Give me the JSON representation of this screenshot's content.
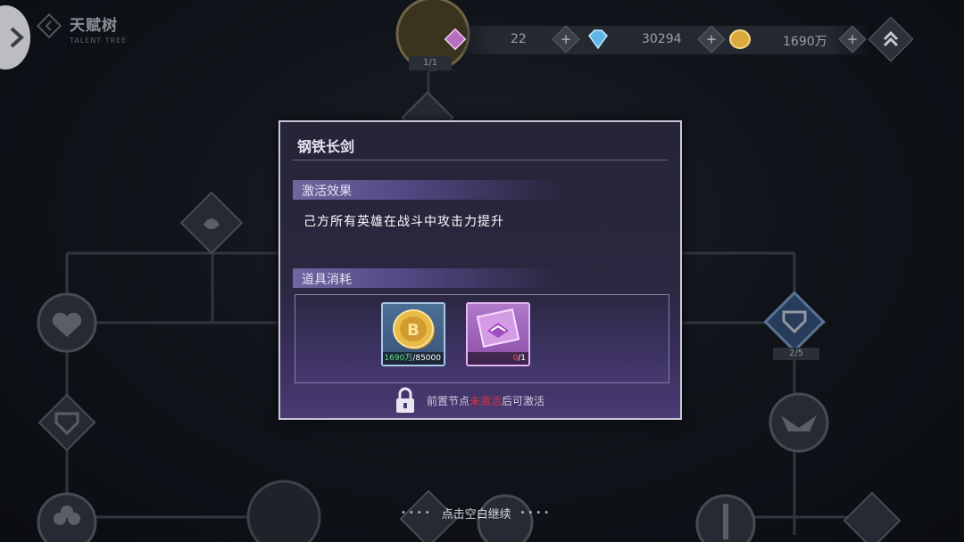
{
  "header": {
    "title": "天赋树",
    "subtitle": "TALENT TREE"
  },
  "resources": {
    "first_value": "22",
    "diamond_value": "30294",
    "gold_value": "1690万"
  },
  "tree": {
    "top_node_progress": "1/1",
    "right_node_progress": "2/5"
  },
  "modal": {
    "title": "钢铁长剑",
    "effect_header": "激活效果",
    "effect_text": "己方所有英雄在战斗中攻击力提升",
    "cost_header": "道具消耗",
    "items": [
      {
        "name": "gold-coin",
        "have": "1690万",
        "need": "85000"
      },
      {
        "name": "purple-crystal",
        "have": "0",
        "need": "1"
      }
    ],
    "lock_prefix": "前置节点",
    "lock_status": "未激活",
    "lock_suffix": "后可激活"
  },
  "footer": {
    "continue_text": "点击空白继续"
  },
  "colors": {
    "modal_bg": "#2a2740",
    "accent_purple": "#6f66a0",
    "ok_green": "#63e58b",
    "warn_red": "#d8313a"
  }
}
